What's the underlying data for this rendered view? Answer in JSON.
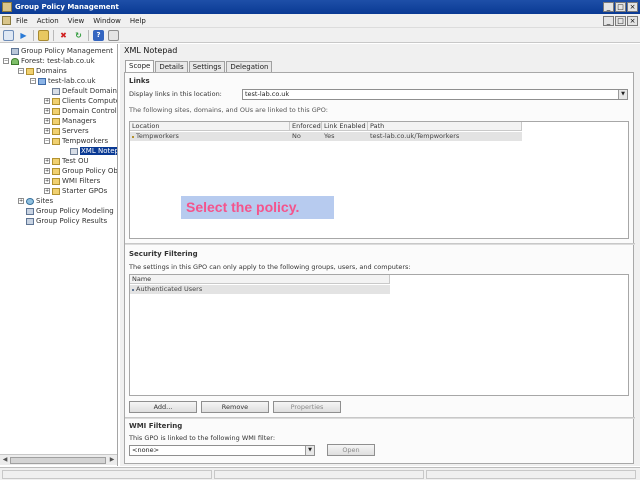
{
  "window": {
    "title": "Group Policy Management"
  },
  "menu": [
    "File",
    "Action",
    "View",
    "Window",
    "Help"
  ],
  "tree": [
    {
      "label": "Group Policy Management",
      "icon": "gpm-icon",
      "level": 0,
      "exp": ""
    },
    {
      "label": "Forest: test-lab.co.uk",
      "icon": "forest-icon",
      "level": 1,
      "exp": "-"
    },
    {
      "label": "Domains",
      "icon": "folder-icon",
      "level": 2,
      "exp": "-"
    },
    {
      "label": "test-lab.co.uk",
      "icon": "domain-icon",
      "level": 3,
      "exp": "-"
    },
    {
      "label": "Default Domain Pol",
      "icon": "gpo-icon",
      "level": 4,
      "exp": ""
    },
    {
      "label": "Clients Computers",
      "icon": "ou-icon",
      "level": 4,
      "exp": "+"
    },
    {
      "label": "Domain Controllers",
      "icon": "ou-icon",
      "level": 4,
      "exp": "+"
    },
    {
      "label": "Managers",
      "icon": "ou-icon",
      "level": 4,
      "exp": "+"
    },
    {
      "label": "Servers",
      "icon": "ou-icon",
      "level": 4,
      "exp": "+"
    },
    {
      "label": "Tempworkers",
      "icon": "ou-icon",
      "level": 4,
      "exp": "-"
    },
    {
      "label": "XML Notepad",
      "icon": "gpo-icon",
      "level": 5,
      "exp": "",
      "selected": true
    },
    {
      "label": "Test OU",
      "icon": "ou-icon",
      "level": 4,
      "exp": "+"
    },
    {
      "label": "Group Policy Objects",
      "icon": "folder-icon",
      "level": 4,
      "exp": "+"
    },
    {
      "label": "WMI Filters",
      "icon": "folder-icon",
      "level": 4,
      "exp": "+"
    },
    {
      "label": "Starter GPOs",
      "icon": "folder-icon",
      "level": 4,
      "exp": "+"
    },
    {
      "label": "Sites",
      "icon": "site-icon",
      "level": 1,
      "exp": "+"
    },
    {
      "label": "Group Policy Modeling",
      "icon": "model-icon",
      "level": 1,
      "exp": ""
    },
    {
      "label": "Group Policy Results",
      "icon": "model-icon",
      "level": 1,
      "exp": ""
    }
  ],
  "details": {
    "title": "XML Notepad",
    "tabs": [
      "Scope",
      "Details",
      "Settings",
      "Delegation"
    ],
    "links": {
      "heading": "Links",
      "display_label": "Display links in this location:",
      "display_value": "test-lab.co.uk",
      "note": "The following sites, domains, and OUs are linked to this GPO:",
      "columns": [
        "Location",
        "Enforced",
        "Link Enabled",
        "Path"
      ],
      "rows": [
        {
          "location": "Tempworkers",
          "enforced": "No",
          "link_enabled": "Yes",
          "path": "test-lab.co.uk/Tempworkers"
        }
      ]
    },
    "security": {
      "heading": "Security Filtering",
      "note": "The settings in this GPO can only apply to the following groups, users, and computers:",
      "columns": [
        "Name"
      ],
      "rows": [
        "Authenticated Users"
      ],
      "buttons": {
        "add": "Add...",
        "remove": "Remove",
        "properties": "Properties"
      }
    },
    "wmi": {
      "heading": "WMI Filtering",
      "note": "This GPO is linked to the following WMI filter:",
      "value": "<none>",
      "open": "Open"
    }
  },
  "callout": {
    "text": "Select the policy."
  }
}
